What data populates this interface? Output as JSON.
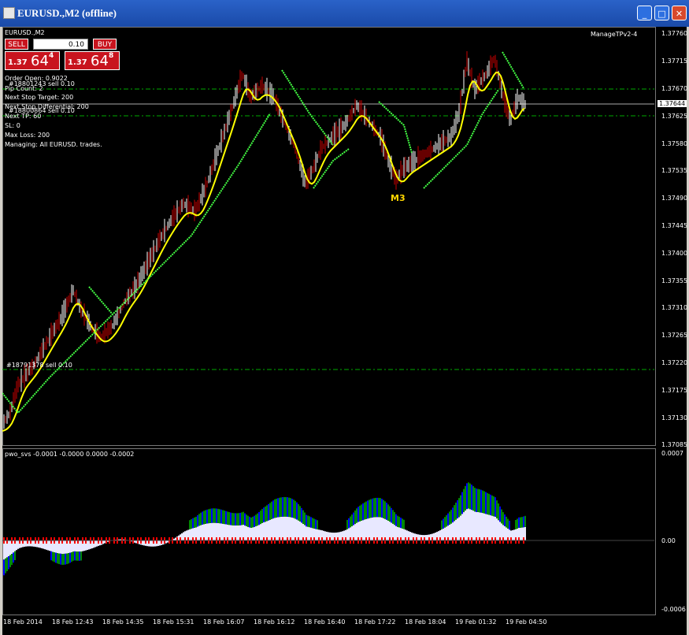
{
  "window": {
    "title": "EURUSD.,M2 (offline)",
    "buttons": [
      "minimize",
      "maximize",
      "close"
    ]
  },
  "chart": {
    "symbol_label": "EURUSD.,M2",
    "ea_label": "ManageTPv2-4",
    "indicator_label": "pwo_svs -0.0001 -0.0000 0.0000 -0.0002",
    "marker_label": "M3",
    "price_axis": [
      "1.37760",
      "1.37715",
      "1.37670",
      "1.37625",
      "1.37580",
      "1.37535",
      "1.37490",
      "1.37445",
      "1.37400",
      "1.37355",
      "1.37310",
      "1.37265",
      "1.37220",
      "1.37175",
      "1.37130",
      "1.37085"
    ],
    "current_price": "1.37644",
    "indicator_axis": [
      "0.0007",
      "0.00",
      "-0.0006"
    ],
    "time_axis": [
      "18 Feb 2014",
      "18 Feb 12:43",
      "18 Feb 14:35",
      "18 Feb 15:31",
      "18 Feb 16:07",
      "18 Feb 16:12",
      "18 Feb 16:40",
      "18 Feb 17:22",
      "18 Feb 18:04",
      "19 Feb 01:32",
      "19 Feb 04:50"
    ]
  },
  "trade_panel": {
    "sell_label": "SELL",
    "buy_label": "BUY",
    "lot": "0.10",
    "sell_small": "1.37",
    "sell_big": "64",
    "sell_sup": "4",
    "buy_small": "1.37",
    "buy_big": "64",
    "buy_sup": "8"
  },
  "info_lines": [
    "Order Open: 0.9022",
    "#18801243 sell 0.10",
    "Pip Count: 2",
    "Next Stop Target: 200",
    "Next Stop Differential: 200",
    "#18800864 sell 0.10",
    "Next TP: 60",
    "SL: 0",
    "Max Loss: 200",
    "Managing: All EURUSD. trades."
  ],
  "trade_lines": [
    "#18791378 sell 0.10"
  ],
  "colors": {
    "background": "#000000",
    "bull_candle": "#ffffff",
    "bear_candle": "#cc0000",
    "ma_yellow": "#ffff00",
    "band_green": "#44ff44",
    "level_green": "#00aa00",
    "hist_red": "#ff0000",
    "hist_blue": "#0000ff",
    "hist_green": "#008800",
    "hist_white": "#e8e8ff"
  }
}
